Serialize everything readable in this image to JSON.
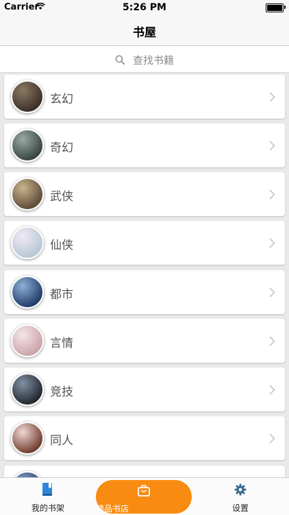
{
  "status_bar": {
    "carrier": "Carrier",
    "time": "5:26 PM"
  },
  "nav": {
    "title": "书屋"
  },
  "search": {
    "placeholder": "查找书籍"
  },
  "categories": [
    {
      "label": "玄幻",
      "thumb_colors": [
        "#3a2e27",
        "#8a7a62"
      ]
    },
    {
      "label": "奇幻",
      "thumb_colors": [
        "#35443f",
        "#9aa9a4"
      ]
    },
    {
      "label": "武侠",
      "thumb_colors": [
        "#5c4a36",
        "#c9b48f"
      ]
    },
    {
      "label": "仙侠",
      "thumb_colors": [
        "#b6c7d4",
        "#efe9f4"
      ]
    },
    {
      "label": "都市",
      "thumb_colors": [
        "#1f3a66",
        "#8fb0d8"
      ]
    },
    {
      "label": "言情",
      "thumb_colors": [
        "#caa2a8",
        "#f4e6ea"
      ]
    },
    {
      "label": "竞技",
      "thumb_colors": [
        "#22262e",
        "#8090a4"
      ]
    },
    {
      "label": "同人",
      "thumb_colors": [
        "#6e3b2c",
        "#f1d7d4"
      ]
    },
    {
      "label": "",
      "thumb_colors": [
        "#2a3f66",
        "#7a9cc8"
      ]
    }
  ],
  "tabs": [
    {
      "label": "我的书架",
      "icon": "book-icon",
      "active": false
    },
    {
      "label": "精品书店",
      "icon": "store-bag-icon",
      "active": true
    },
    {
      "label": "设置",
      "icon": "gear-icon",
      "active": false
    }
  ],
  "colors": {
    "accent": "#f88c12",
    "tab_icon_blue": "#2f86d8"
  }
}
